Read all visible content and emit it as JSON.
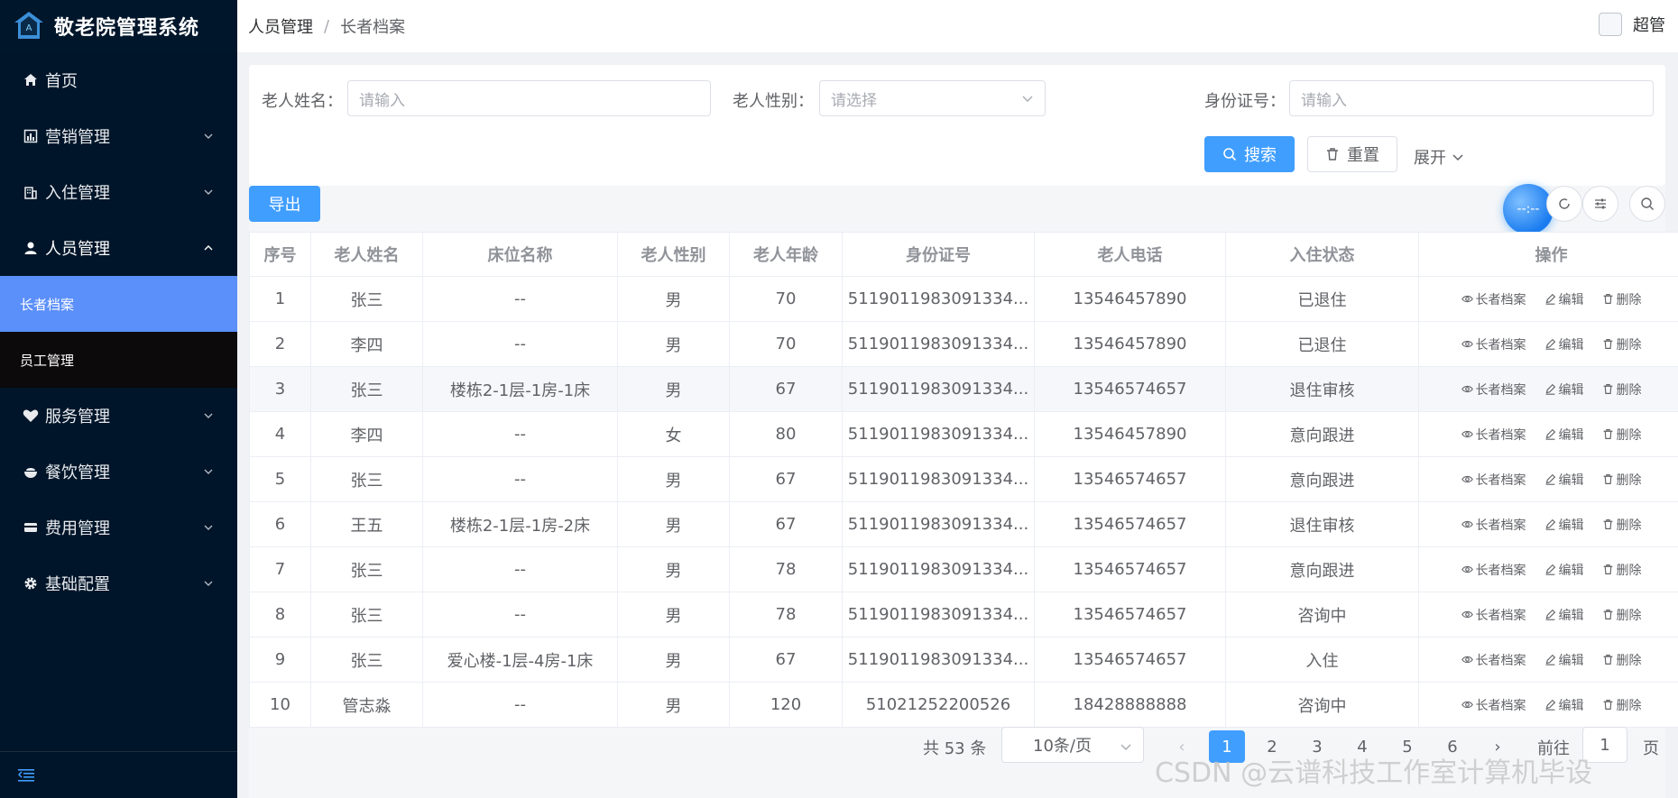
{
  "app": {
    "title": "敬老院管理系统"
  },
  "sidebar": {
    "items": [
      {
        "label": "首页",
        "icon": "home-icon"
      },
      {
        "label": "营销管理",
        "icon": "chart-icon"
      },
      {
        "label": "入住管理",
        "icon": "building-icon"
      },
      {
        "label": "人员管理",
        "icon": "user-icon"
      },
      {
        "label": "服务管理",
        "icon": "heart-icon"
      },
      {
        "label": "餐饮管理",
        "icon": "bowl-icon"
      },
      {
        "label": "费用管理",
        "icon": "card-icon"
      },
      {
        "label": "基础配置",
        "icon": "gear-icon"
      }
    ],
    "sub_items": [
      {
        "label": "长者档案"
      },
      {
        "label": "员工管理"
      }
    ]
  },
  "header": {
    "breadcrumb": [
      "人员管理",
      "长者档案"
    ],
    "breadcrumb_sep": "/",
    "user_name": "超管"
  },
  "search": {
    "name_label": "老人姓名：",
    "name_placeholder": "请输入",
    "gender_label": "老人性别：",
    "gender_placeholder": "请选择",
    "id_label": "身份证号：",
    "id_placeholder": "请输入",
    "search_button": "搜索",
    "reset_button": "重置",
    "expand_button": "展开"
  },
  "toolbar": {
    "export_button": "导出",
    "float_label": "--:--"
  },
  "table": {
    "columns": [
      "序号",
      "老人姓名",
      "床位名称",
      "老人性别",
      "老人年龄",
      "身份证号",
      "老人电话",
      "入住状态",
      "操作"
    ],
    "actions": [
      "长者档案",
      "编辑",
      "删除"
    ],
    "rows": [
      {
        "no": "1",
        "name": "张三",
        "bed": "--",
        "gender": "男",
        "age": "70",
        "id": "5119011983091334...",
        "phone": "13546457890",
        "status": "已退住"
      },
      {
        "no": "2",
        "name": "李四",
        "bed": "--",
        "gender": "男",
        "age": "70",
        "id": "5119011983091334...",
        "phone": "13546457890",
        "status": "已退住"
      },
      {
        "no": "3",
        "name": "张三",
        "bed": "楼栋2-1层-1房-1床",
        "gender": "男",
        "age": "67",
        "id": "5119011983091334...",
        "phone": "13546574657",
        "status": "退住审核"
      },
      {
        "no": "4",
        "name": "李四",
        "bed": "--",
        "gender": "女",
        "age": "80",
        "id": "5119011983091334...",
        "phone": "13546457890",
        "status": "意向跟进"
      },
      {
        "no": "5",
        "name": "张三",
        "bed": "--",
        "gender": "男",
        "age": "67",
        "id": "5119011983091334...",
        "phone": "13546574657",
        "status": "意向跟进"
      },
      {
        "no": "6",
        "name": "王五",
        "bed": "楼栋2-1层-1房-2床",
        "gender": "男",
        "age": "67",
        "id": "5119011983091334...",
        "phone": "13546574657",
        "status": "退住审核"
      },
      {
        "no": "7",
        "name": "张三",
        "bed": "--",
        "gender": "男",
        "age": "78",
        "id": "5119011983091334...",
        "phone": "13546574657",
        "status": "意向跟进"
      },
      {
        "no": "8",
        "name": "张三",
        "bed": "--",
        "gender": "男",
        "age": "78",
        "id": "5119011983091334...",
        "phone": "13546574657",
        "status": "咨询中"
      },
      {
        "no": "9",
        "name": "张三",
        "bed": "爱心楼-1层-4房-1床",
        "gender": "男",
        "age": "67",
        "id": "5119011983091334...",
        "phone": "13546574657",
        "status": "入住"
      },
      {
        "no": "10",
        "name": "管志淼",
        "bed": "--",
        "gender": "男",
        "age": "120",
        "id": "51021252200526",
        "phone": "18428888888",
        "status": "咨询中"
      }
    ],
    "highlight_row": 3
  },
  "pagination": {
    "total_text": "共 53 条",
    "page_size": "10条/页",
    "prev": "‹",
    "next": "›",
    "pages": [
      "1",
      "2",
      "3",
      "4",
      "5",
      "6"
    ],
    "current": "1",
    "goto_label": "前往",
    "goto_value": "1",
    "page_suffix": "页"
  },
  "watermark": "CSDN @云谱科技工作室计算机毕设",
  "colors": {
    "sidebar_bg": "#001529",
    "primary": "#409eff",
    "active_menu": "#5b8ff9"
  }
}
